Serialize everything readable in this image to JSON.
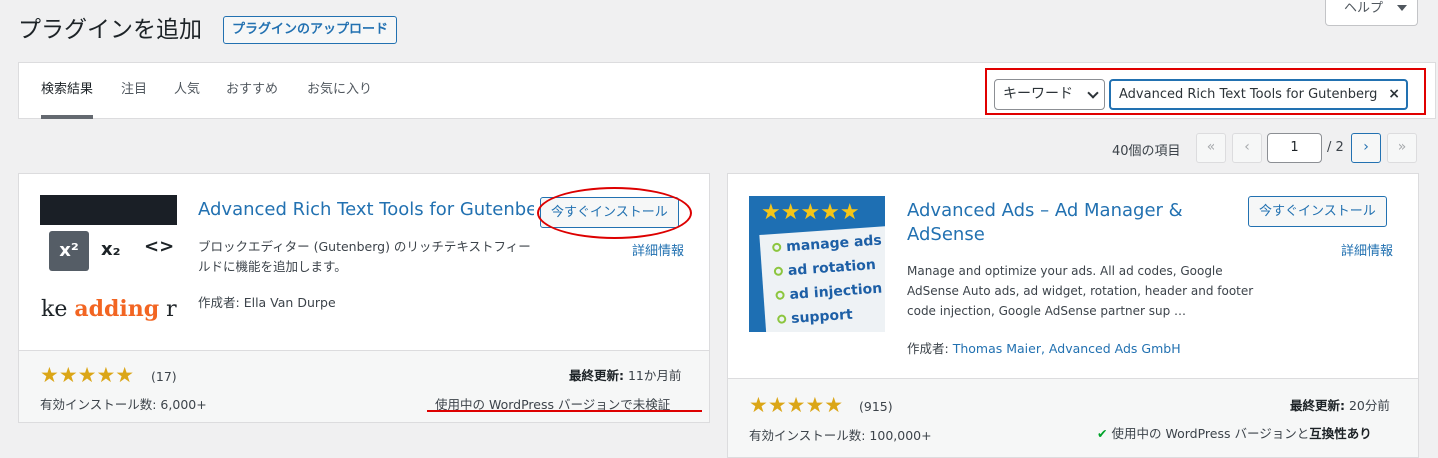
{
  "header": {
    "title": "プラグインを追加",
    "upload_label": "プラグインのアップロード",
    "help_label": "ヘルプ"
  },
  "tabs": [
    {
      "label": "検索結果",
      "active": true
    },
    {
      "label": "注目"
    },
    {
      "label": "人気"
    },
    {
      "label": "おすすめ"
    },
    {
      "label": "お気に入り"
    }
  ],
  "search": {
    "type_value": "キーワード",
    "query": "Advanced Rich Text Tools for Gutenberg",
    "clear_icon": "×"
  },
  "pagination": {
    "count": "40個の項目",
    "first": "«",
    "prev": "‹",
    "current": "1",
    "total": "/ 2",
    "next": "›",
    "last": "»"
  },
  "plugins": [
    {
      "title": "Advanced Rich Text Tools for Gutenberg",
      "install_label": "今すぐインストール",
      "more_label": "詳細情報",
      "description_line1": "ブロックエディター (Gutenberg) のリッチテキストフィー",
      "description_line2": "ルドに機能を追加します。",
      "author_label": "作成者:",
      "author_name": "Ella Van Durpe",
      "stars": "★★★★★",
      "rating_count": "(17)",
      "active_installs": "有効インストール数: 6,000+",
      "last_updated_label": "最終更新:",
      "last_updated_value": "11か月前",
      "compat": "使用中の WordPress バージョンで未検証",
      "thumb": {
        "sup": "x²",
        "sub": "x₂",
        "code": "<>",
        "tag_pre": "ke ",
        "tag_hl": "adding",
        "tag_post": " ric"
      }
    },
    {
      "title_line1": "Advanced Ads – Ad Manager &",
      "title_line2": "AdSense",
      "install_label": "今すぐインストール",
      "more_label": "詳細情報",
      "description_line1": "Manage and optimize your ads. All ad codes, Google",
      "description_line2": "AdSense Auto ads, ad widget, rotation, header and footer",
      "description_line3": "code injection, Google AdSense partner sup …",
      "author_label": "作成者:",
      "author_name": "Thomas Maier, Advanced Ads GmbH",
      "stars": "★★★★★",
      "rating_count": "(915)",
      "active_installs": "有効インストール数: 100,000+",
      "last_updated_label": "最終更新:",
      "last_updated_value": "20分前",
      "compat_check": "✔",
      "compat_pre": "使用中の WordPress バージョンと",
      "compat_bold": "互換性あり",
      "thumb": {
        "stars": "★★★★★",
        "items": [
          "manage ads",
          "ad rotation",
          "ad injection",
          "support"
        ]
      }
    }
  ]
}
